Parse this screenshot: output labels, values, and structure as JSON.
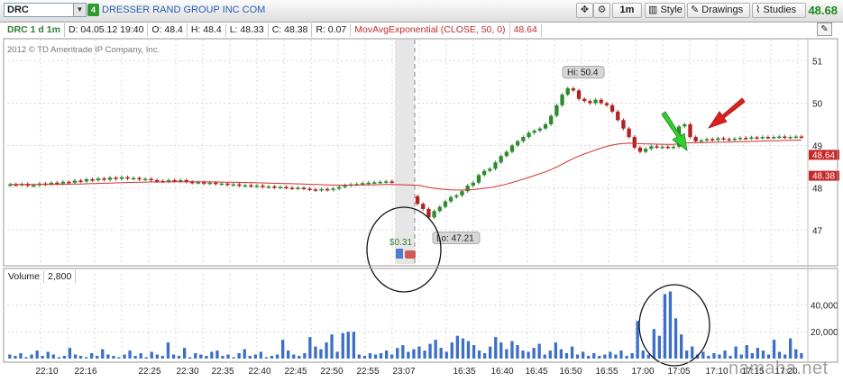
{
  "toolbar": {
    "symbol": "DRC",
    "link_badge": "4",
    "company_name": "DRESSER RAND GROUP INC COM",
    "interval_button": "1m",
    "style_button": "Style",
    "drawings_button": "Drawings",
    "studies_button": "Studies",
    "last_price": "48.68",
    "colors": {
      "last_price": "#1c8a1c",
      "link_badge": "#2f9a2f"
    }
  },
  "info_bar": {
    "symbol_period": "DRC 1 d 1m",
    "date": "D: 04.05.12 19:40",
    "open": "O: 48.4",
    "high": "H: 48.4",
    "low": "L: 48.33",
    "close": "C: 48.38",
    "range": "R: 0.07",
    "study_name": "MovAvgExponential (CLOSE, 50, 0)",
    "study_value": "48.64"
  },
  "copyright": "2012 © TD Ameritrade IP Company, Inc.",
  "volume_header": {
    "label": "Volume",
    "value": "2,800"
  },
  "watermark": "namaha.net",
  "chart_data": [
    {
      "type": "candlestick",
      "title": "",
      "y_ticks": [
        47,
        48,
        49,
        50,
        51
      ],
      "ylim": [
        46.2,
        51.5
      ],
      "grid": true,
      "y_axis_side": "right",
      "price_badges": [
        {
          "label": "48.64",
          "value": 48.64,
          "color": "#c62828"
        },
        {
          "label": "48.38",
          "value": 48.38,
          "color": "#c62828"
        }
      ],
      "annotations": [
        {
          "label": "Hi: 50.4",
          "value": 50.4
        },
        {
          "label": "Lo: 47.21",
          "value": 47.21
        },
        {
          "label": "$0.31",
          "color": "#2e7d32"
        }
      ],
      "colors": {
        "up": "#2e8b2e",
        "down": "#b22222",
        "moving_average": "#d32f2f"
      },
      "moving_average_name": "MovAvgExponential (CLOSE, 50, 0)",
      "candles_day1": [
        [
          48.06,
          48.08
        ],
        [
          48.08,
          48.07
        ],
        [
          48.07,
          48.09
        ],
        [
          48.09,
          48.05
        ],
        [
          48.05,
          48.06
        ],
        [
          48.06,
          48.1
        ],
        [
          48.1,
          48.08
        ],
        [
          48.08,
          48.12
        ],
        [
          48.12,
          48.1
        ],
        [
          48.1,
          48.14
        ],
        [
          48.14,
          48.12
        ],
        [
          48.12,
          48.17
        ],
        [
          48.17,
          48.15
        ],
        [
          48.15,
          48.2
        ],
        [
          48.2,
          48.18
        ],
        [
          48.18,
          48.22
        ],
        [
          48.22,
          48.19
        ],
        [
          48.19,
          48.24
        ],
        [
          48.24,
          48.21
        ],
        [
          48.21,
          48.25
        ],
        [
          48.25,
          48.22
        ],
        [
          48.22,
          48.23
        ],
        [
          48.23,
          48.2
        ],
        [
          48.2,
          48.21
        ],
        [
          48.21,
          48.18
        ],
        [
          48.18,
          48.16
        ],
        [
          48.16,
          48.15
        ],
        [
          48.15,
          48.18
        ],
        [
          48.18,
          48.16
        ],
        [
          48.16,
          48.18
        ],
        [
          48.18,
          48.14
        ],
        [
          48.14,
          48.12
        ],
        [
          48.12,
          48.13
        ],
        [
          48.13,
          48.1
        ],
        [
          48.1,
          48.12
        ],
        [
          48.12,
          48.09
        ],
        [
          48.09,
          48.1
        ],
        [
          48.1,
          48.07
        ],
        [
          48.07,
          48.08
        ],
        [
          48.08,
          48.05
        ],
        [
          48.05,
          48.06
        ],
        [
          48.06,
          48.04
        ],
        [
          48.04,
          48.05
        ],
        [
          48.05,
          48.02
        ],
        [
          48.02,
          48.03
        ],
        [
          48.03,
          48.01
        ],
        [
          48.01,
          48.02
        ],
        [
          48.02,
          48.0
        ],
        [
          48.0,
          47.99
        ],
        [
          47.99,
          48.0
        ],
        [
          48.0,
          47.98
        ],
        [
          47.98,
          47.96
        ],
        [
          47.96,
          47.94
        ],
        [
          47.94,
          47.97
        ],
        [
          47.97,
          47.95
        ],
        [
          47.95,
          47.98
        ],
        [
          47.98,
          48.02
        ],
        [
          48.02,
          48.06
        ],
        [
          48.06,
          48.08
        ],
        [
          48.08,
          48.09
        ],
        [
          48.09,
          48.11
        ],
        [
          48.11,
          48.12
        ],
        [
          48.12,
          48.13
        ],
        [
          48.13,
          48.14
        ],
        [
          48.14,
          48.15
        ],
        [
          48.15,
          48.14
        ]
      ],
      "candles_day2": [
        [
          47.8,
          47.62
        ],
        [
          47.62,
          47.5
        ],
        [
          47.5,
          47.3
        ],
        [
          47.3,
          47.45
        ],
        [
          47.45,
          47.55
        ],
        [
          47.55,
          47.68
        ],
        [
          47.68,
          47.78
        ],
        [
          47.78,
          47.82
        ],
        [
          47.82,
          47.92
        ],
        [
          47.92,
          48.05
        ],
        [
          48.05,
          48.12
        ],
        [
          48.12,
          48.3
        ],
        [
          48.3,
          48.4
        ],
        [
          48.4,
          48.45
        ],
        [
          48.45,
          48.6
        ],
        [
          48.6,
          48.75
        ],
        [
          48.75,
          48.85
        ],
        [
          48.85,
          49.0
        ],
        [
          49.0,
          49.1
        ],
        [
          49.1,
          49.2
        ],
        [
          49.2,
          49.3
        ],
        [
          49.3,
          49.35
        ],
        [
          49.35,
          49.4
        ],
        [
          49.4,
          49.5
        ],
        [
          49.5,
          49.7
        ],
        [
          49.7,
          49.95
        ],
        [
          49.95,
          50.2
        ],
        [
          50.2,
          50.35
        ],
        [
          50.35,
          50.3
        ],
        [
          50.3,
          50.1
        ],
        [
          50.1,
          50.05
        ],
        [
          50.05,
          50.0
        ],
        [
          50.0,
          50.08
        ],
        [
          50.08,
          50.0
        ],
        [
          50.0,
          49.95
        ],
        [
          49.95,
          49.8
        ],
        [
          49.8,
          49.6
        ],
        [
          49.6,
          49.4
        ],
        [
          49.4,
          49.2
        ],
        [
          49.2,
          48.95
        ],
        [
          48.95,
          48.85
        ],
        [
          48.85,
          48.92
        ],
        [
          48.92,
          48.98
        ],
        [
          48.98,
          48.96
        ],
        [
          48.96,
          48.97
        ],
        [
          48.97,
          48.95
        ],
        [
          48.95,
          48.97
        ],
        [
          48.97,
          49.45
        ],
        [
          49.45,
          49.5
        ],
        [
          49.5,
          49.2
        ],
        [
          49.2,
          49.1
        ],
        [
          49.1,
          49.12
        ],
        [
          49.12,
          49.15
        ],
        [
          49.15,
          49.13
        ],
        [
          49.13,
          49.17
        ],
        [
          49.17,
          49.15
        ],
        [
          49.15,
          49.14
        ],
        [
          49.14,
          49.16
        ],
        [
          49.16,
          49.18
        ],
        [
          49.18,
          49.17
        ],
        [
          49.17,
          49.19
        ],
        [
          49.19,
          49.18
        ],
        [
          49.18,
          49.2
        ],
        [
          49.2,
          49.19
        ],
        [
          49.19,
          49.2
        ],
        [
          49.2,
          49.21
        ],
        [
          49.21,
          49.19
        ],
        [
          49.19,
          49.2
        ],
        [
          49.2,
          49.21
        ],
        [
          49.21,
          49.2
        ]
      ]
    },
    {
      "type": "bar",
      "title": "Volume",
      "y_ticks": [
        20000,
        40000
      ],
      "y_tick_labels": [
        "20,000",
        "40,000"
      ],
      "ylim": [
        0,
        55000
      ],
      "grid": true,
      "x_tick_labels": [
        "22:10",
        "22:16",
        "22:25",
        "22:30",
        "22:35",
        "22:40",
        "22:45",
        "22:50",
        "22:55",
        "23:07",
        "16:35",
        "16:40",
        "16:45",
        "16:50",
        "16:55",
        "17:00",
        "17:05",
        "17:10",
        "17:15",
        "17:20"
      ],
      "color": "#3c6fc8",
      "values": [
        3000,
        2000,
        4000,
        1000,
        3000,
        6000,
        2000,
        5000,
        3000,
        1000,
        2000,
        8000,
        3000,
        2000,
        1000,
        4000,
        2000,
        7000,
        3000,
        2000,
        1000,
        3000,
        6000,
        2000,
        4000,
        1000,
        5000,
        3000,
        2000,
        12000,
        3000,
        2000,
        8000,
        1000,
        4000,
        3000,
        2000,
        5000,
        6000,
        2000,
        3000,
        1000,
        4000,
        7000,
        2000,
        3000,
        5000,
        1000,
        2000,
        3000,
        14000,
        6000,
        3000,
        2000,
        4000,
        16000,
        9000,
        7000,
        12000,
        18000,
        5000,
        19000,
        20000,
        20000,
        3000,
        2000,
        4000,
        3000,
        4000,
        6000,
        3000,
        8000,
        10000,
        5000,
        7000,
        9000,
        6000,
        11000,
        14000,
        8000,
        5000,
        12000,
        17000,
        15000,
        13000,
        10000,
        6000,
        4000,
        9000,
        16000,
        12000,
        7000,
        13000,
        10000,
        6000,
        5000,
        8000,
        11000,
        3000,
        6000,
        12000,
        7000,
        4000,
        9000,
        3000,
        5000,
        2000,
        4000,
        2000,
        3000,
        5000,
        3000,
        6000,
        2000,
        4000,
        28000,
        6000,
        3000,
        22000,
        17000,
        48000,
        50000,
        30000,
        18000,
        6000,
        9000,
        3000,
        5000,
        2000,
        4000,
        3000,
        6000,
        2000,
        9000,
        3000,
        10000,
        4000,
        8000,
        6000,
        3000,
        14000,
        5000,
        3000,
        15000,
        7000,
        4000
      ]
    }
  ]
}
